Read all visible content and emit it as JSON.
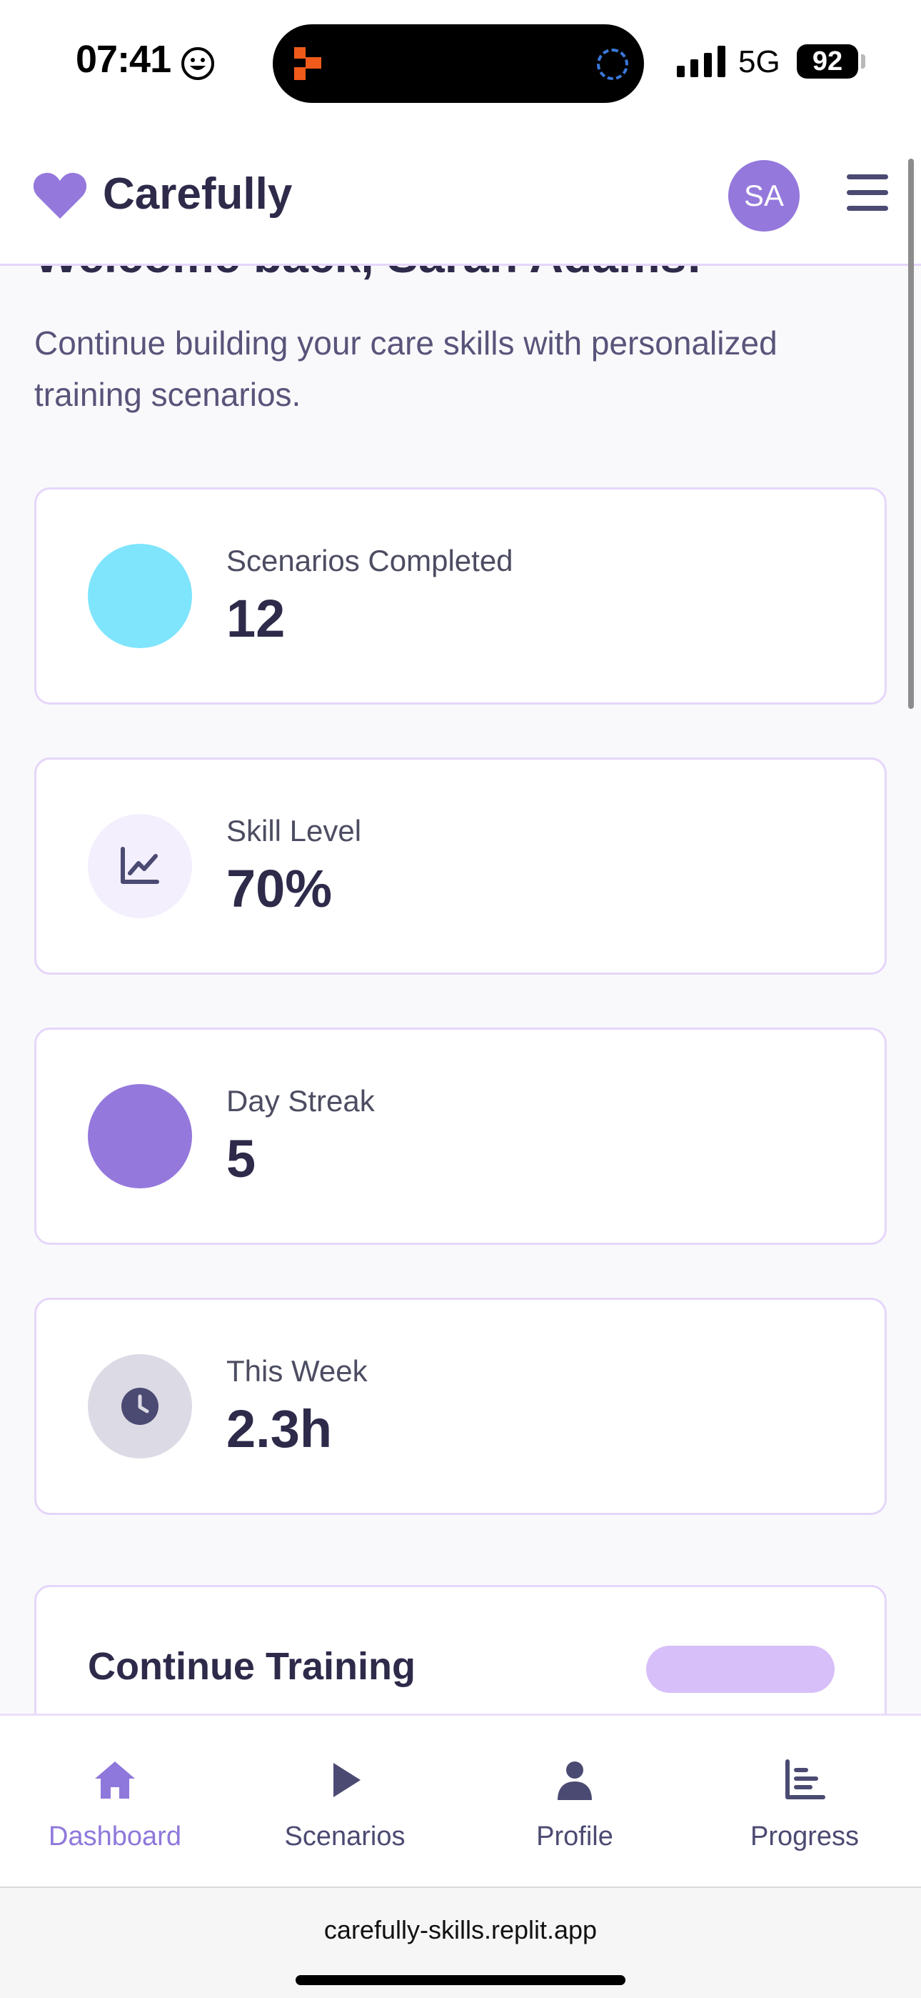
{
  "status_bar": {
    "time": "07:41",
    "network": "5G",
    "battery": "92"
  },
  "header": {
    "app_name": "Carefully",
    "avatar_initials": "SA",
    "brand_color": "#9478dc"
  },
  "main": {
    "welcome": "Welcome back, Sarah Adams!",
    "subtitle": "Continue building your care skills with personalized training scenarios.",
    "stats": [
      {
        "label": "Scenarios Completed",
        "value": "12",
        "icon": "cyan-circle-icon",
        "icon_color": "#7ee5fd"
      },
      {
        "label": "Skill Level",
        "value": "70%",
        "icon": "chart-line-icon",
        "icon_color": "#f4effd"
      },
      {
        "label": "Day Streak",
        "value": "5",
        "icon": "purple-circle-icon",
        "icon_color": "#9478dc"
      },
      {
        "label": "This Week",
        "value": "2.3h",
        "icon": "clock-icon",
        "icon_color": "#dcdbe5"
      }
    ],
    "training": {
      "title": "Continue Training"
    }
  },
  "bottom_nav": {
    "items": [
      {
        "label": "Dashboard",
        "icon": "home-icon",
        "active": true
      },
      {
        "label": "Scenarios",
        "icon": "play-icon",
        "active": false
      },
      {
        "label": "Profile",
        "icon": "user-icon",
        "active": false
      },
      {
        "label": "Progress",
        "icon": "bar-chart-icon",
        "active": false
      }
    ]
  },
  "browser": {
    "url": "carefully-skills.replit.app"
  }
}
